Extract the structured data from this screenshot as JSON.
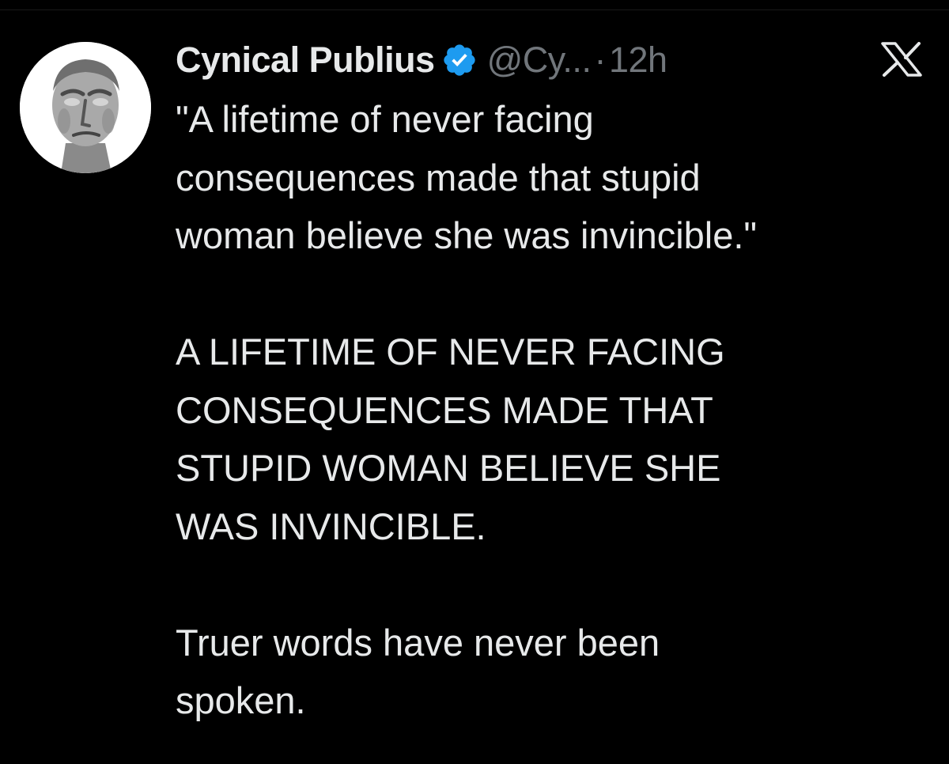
{
  "tweet": {
    "author": {
      "display_name": "Cynical Publius",
      "handle": "@Cy...",
      "verified": true,
      "avatar": "roman-bust-portrait"
    },
    "separator": "·",
    "time_ago": "12h",
    "close_icon": "x-logo-icon",
    "body": "\"A lifetime of never facing\nconsequences made that stupid\nwoman believe she was invincible.\"\n\nA LIFETIME OF NEVER FACING\nCONSEQUENCES MADE THAT\nSTUPID WOMAN BELIEVE SHE\nWAS INVINCIBLE.\n\nTruer words have never been\nspoken."
  },
  "colors": {
    "background": "#000000",
    "primary_text": "#e7e9ea",
    "secondary_text": "#71767b",
    "verified_blue": "#1d9bf0"
  }
}
